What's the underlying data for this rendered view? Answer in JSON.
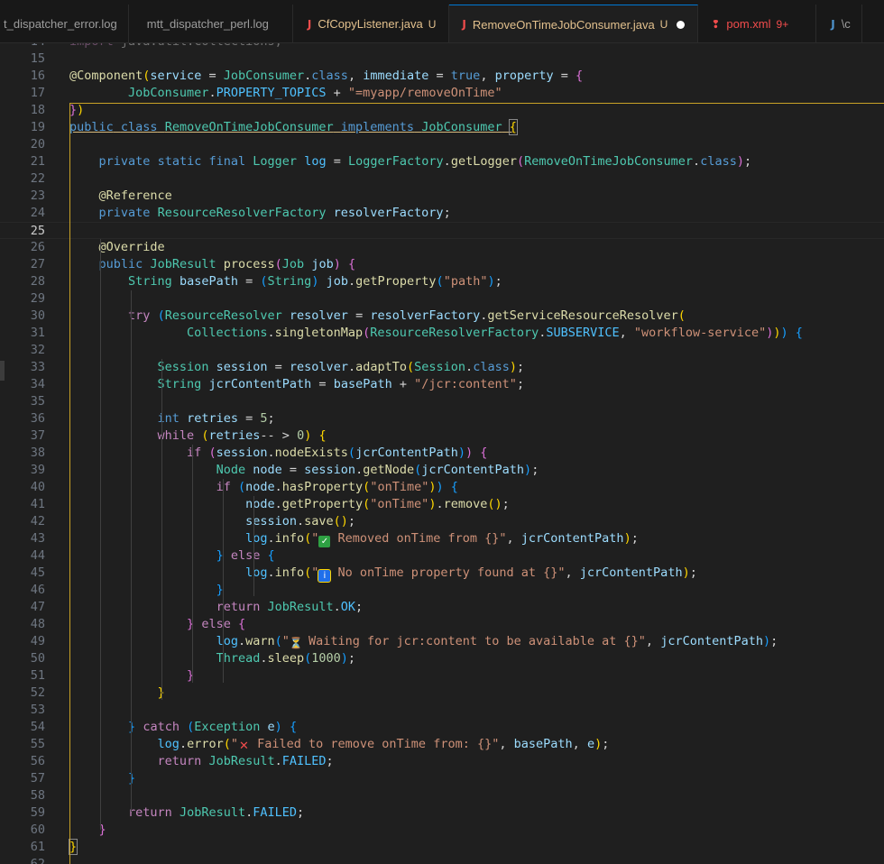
{
  "tabs": [
    {
      "label": "t_dispatcher_error.log",
      "icon": "log-file-icon",
      "badge": "",
      "active": false
    },
    {
      "label": "mtt_dispatcher_perl.log",
      "icon": "log-file-icon",
      "badge": "",
      "active": false
    },
    {
      "label": "CfCopyListener.java",
      "icon": "java-file-icon",
      "badge": "U",
      "active": false
    },
    {
      "label": "RemoveOnTimeJobConsumer.java",
      "icon": "java-file-icon",
      "badge": "U",
      "active": true,
      "dirty": true
    },
    {
      "label": "pom.xml",
      "icon": "xml-file-icon",
      "badge": "9+",
      "active": false
    },
    {
      "label": "\\c",
      "icon": "file-icon",
      "badge": "",
      "active": false
    }
  ],
  "editor": {
    "current_line": 25,
    "lines": [
      {
        "n": 14,
        "text": "import java.util.Collections;"
      },
      {
        "n": 15,
        "text": ""
      },
      {
        "n": 16,
        "text": "@Component(service = JobConsumer.class, immediate = true, property = {"
      },
      {
        "n": 17,
        "text": "        JobConsumer.PROPERTY_TOPICS + \"=myapp/removeOnTime\""
      },
      {
        "n": 18,
        "text": "})"
      },
      {
        "n": 19,
        "text": "public class RemoveOnTimeJobConsumer implements JobConsumer {"
      },
      {
        "n": 20,
        "text": ""
      },
      {
        "n": 21,
        "text": "    private static final Logger log = LoggerFactory.getLogger(RemoveOnTimeJobConsumer.class);"
      },
      {
        "n": 22,
        "text": ""
      },
      {
        "n": 23,
        "text": "    @Reference"
      },
      {
        "n": 24,
        "text": "    private ResourceResolverFactory resolverFactory;"
      },
      {
        "n": 25,
        "text": ""
      },
      {
        "n": 26,
        "text": "    @Override"
      },
      {
        "n": 27,
        "text": "    public JobResult process(Job job) {"
      },
      {
        "n": 28,
        "text": "        String basePath = (String) job.getProperty(\"path\");"
      },
      {
        "n": 29,
        "text": ""
      },
      {
        "n": 30,
        "text": "        try (ResourceResolver resolver = resolverFactory.getServiceResourceResolver("
      },
      {
        "n": 31,
        "text": "                Collections.singletonMap(ResourceResolverFactory.SUBSERVICE, \"workflow-service\"))) {"
      },
      {
        "n": 32,
        "text": ""
      },
      {
        "n": 33,
        "text": "            Session session = resolver.adaptTo(Session.class);"
      },
      {
        "n": 34,
        "text": "            String jcrContentPath = basePath + \"/jcr:content\";"
      },
      {
        "n": 35,
        "text": ""
      },
      {
        "n": 36,
        "text": "            int retries = 5;"
      },
      {
        "n": 37,
        "text": "            while (retries-- > 0) {"
      },
      {
        "n": 38,
        "text": "                if (session.nodeExists(jcrContentPath)) {"
      },
      {
        "n": 39,
        "text": "                    Node node = session.getNode(jcrContentPath);"
      },
      {
        "n": 40,
        "text": "                    if (node.hasProperty(\"onTime\")) {"
      },
      {
        "n": 41,
        "text": "                        node.getProperty(\"onTime\").remove();"
      },
      {
        "n": 42,
        "text": "                        session.save();"
      },
      {
        "n": 43,
        "text": "                        log.info(\"✅ Removed onTime from {}\", jcrContentPath);"
      },
      {
        "n": 44,
        "text": "                    } else {"
      },
      {
        "n": 45,
        "text": "                        log.info(\"ℹ️ No onTime property found at {}\", jcrContentPath);"
      },
      {
        "n": 46,
        "text": "                    }"
      },
      {
        "n": 47,
        "text": "                    return JobResult.OK;"
      },
      {
        "n": 48,
        "text": "                } else {"
      },
      {
        "n": 49,
        "text": "                    log.warn(\"⏳ Waiting for jcr:content to be available at {}\", jcrContentPath);"
      },
      {
        "n": 50,
        "text": "                    Thread.sleep(1000);"
      },
      {
        "n": 51,
        "text": "                }"
      },
      {
        "n": 52,
        "text": "            }"
      },
      {
        "n": 53,
        "text": ""
      },
      {
        "n": 54,
        "text": "        } catch (Exception e) {"
      },
      {
        "n": 55,
        "text": "            log.error(\"❌ Failed to remove onTime from: {}\", basePath, e);"
      },
      {
        "n": 56,
        "text": "            return JobResult.FAILED;"
      },
      {
        "n": 57,
        "text": "        }"
      },
      {
        "n": 58,
        "text": ""
      },
      {
        "n": 59,
        "text": "        return JobResult.FAILED;"
      },
      {
        "n": 60,
        "text": "    }"
      },
      {
        "n": 61,
        "text": "}"
      },
      {
        "n": 62,
        "text": ""
      }
    ]
  },
  "colors": {
    "editor_bg": "#1f1f1f",
    "tab_bg": "#181818",
    "active_border": "#0078d4",
    "bracket_guide": "#c9a227",
    "git_untracked": "#e2c08d",
    "error": "#f14c4c"
  }
}
